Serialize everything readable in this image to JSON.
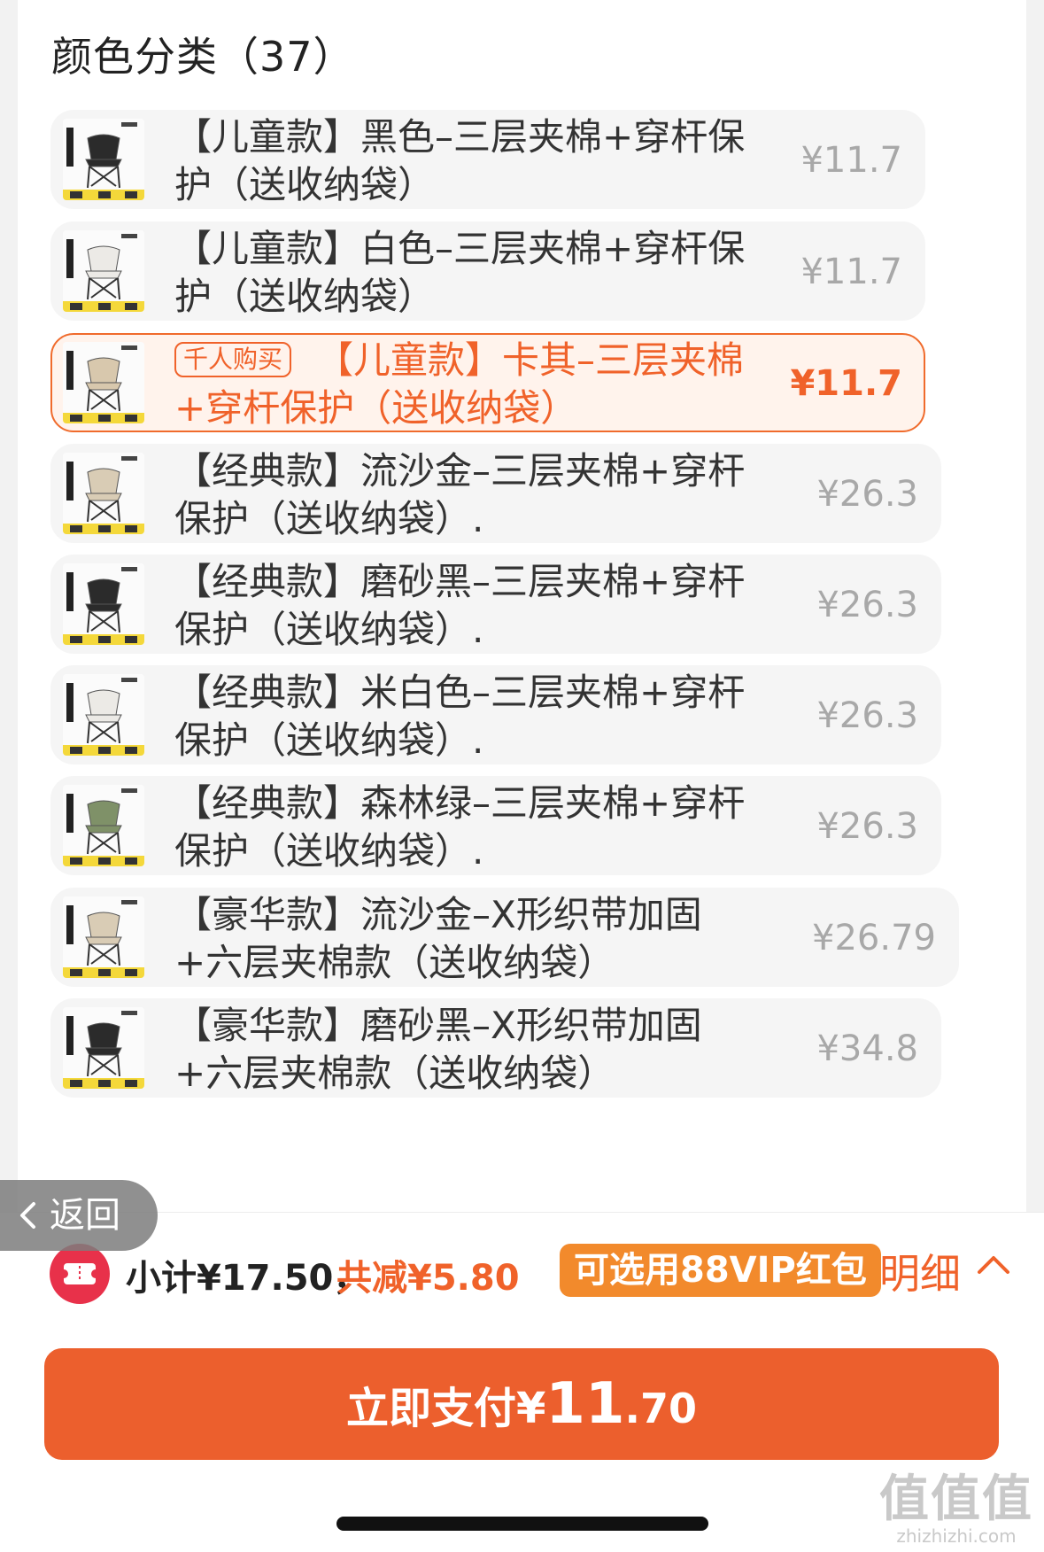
{
  "section_title": "颜色分类（37）",
  "options": [
    {
      "text": "【儿童款】黑色–三层夹棉+穿杆保护（送收纳袋）",
      "price": "¥11.7",
      "chair_color": "#2b2b2b",
      "selected": false,
      "badge": ""
    },
    {
      "text": "【儿童款】白色–三层夹棉+穿杆保护（送收纳袋）",
      "price": "¥11.7",
      "chair_color": "#eceae6",
      "selected": false,
      "badge": ""
    },
    {
      "text": "【儿童款】卡其–三层夹棉+穿杆保护（送收纳袋）",
      "price": "¥11.7",
      "chair_color": "#d8c8ad",
      "selected": true,
      "badge": "千人购买"
    },
    {
      "text": "【经典款】流沙金–三层夹棉+穿杆保护（送收纳袋）.",
      "price": "¥26.3",
      "chair_color": "#d9ccb5",
      "selected": false,
      "badge": ""
    },
    {
      "text": "【经典款】磨砂黑–三层夹棉+穿杆保护（送收纳袋）.",
      "price": "¥26.3",
      "chair_color": "#2b2b2b",
      "selected": false,
      "badge": ""
    },
    {
      "text": "【经典款】米白色–三层夹棉+穿杆保护（送收纳袋）.",
      "price": "¥26.3",
      "chair_color": "#eceae6",
      "selected": false,
      "badge": ""
    },
    {
      "text": "【经典款】森林绿–三层夹棉+穿杆保护（送收纳袋）.",
      "price": "¥26.3",
      "chair_color": "#7f9168",
      "selected": false,
      "badge": ""
    },
    {
      "text": "【豪华款】流沙金–X形织带加固+六层夹棉款（送收纳袋）",
      "price": "¥26.79",
      "chair_color": "#d9ccb5",
      "selected": false,
      "badge": ""
    },
    {
      "text": "【豪华款】磨砂黑–X形织带加固+六层夹棉款（送收纳袋）",
      "price": "¥34.8",
      "chair_color": "#2b2b2b",
      "selected": false,
      "badge": ""
    }
  ],
  "back": {
    "label": "返回"
  },
  "summary": {
    "subtotal": "小计¥17.50，",
    "discount": "共减¥5.80",
    "vip_tag": "可选用88VIP红包",
    "detail_label": "明细"
  },
  "pay_button": {
    "prefix": "立即支付¥",
    "amount_int": "11",
    "amount_dec": ".70"
  },
  "watermark": {
    "title": "值值值",
    "url": "zhizhizhi.com"
  },
  "colors": {
    "accent": "#f0622a",
    "pay_button": "#ec5f2d",
    "vip_tag": "#f28a2c",
    "coupon_icon": "#e8314a"
  }
}
